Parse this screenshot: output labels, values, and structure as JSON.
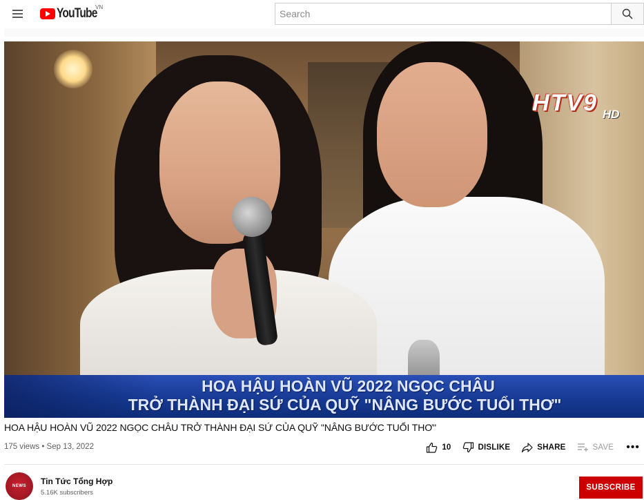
{
  "header": {
    "logo_text": "YouTube",
    "country_code": "VN",
    "search_placeholder": "Search"
  },
  "player": {
    "channel_logo": "HTV9",
    "channel_logo_hd": "HD",
    "caption_line1": "HOA HẬU HOÀN VŨ 2022 NGỌC CHÂU",
    "caption_line2": "TRỞ THÀNH ĐẠI SỨ CỦA QUỸ \"NÂNG BƯỚC TUỔI THƠ\""
  },
  "video": {
    "title": "HOA HẬU HOÀN VŨ 2022 NGỌC CHÂU TRỞ THÀNH ĐẠI SỨ CỦA QUỸ \"NÂNG BƯỚC TUỔI THƠ\"",
    "meta": "175 views • Sep 13, 2022",
    "like_count": "10",
    "dislike_label": "DISLIKE",
    "share_label": "SHARE",
    "save_label": "SAVE",
    "more_label": "•••"
  },
  "channel": {
    "name": "Tin Tức Tổng Hợp",
    "subscribers": "5.16K subscribers",
    "avatar_text": "NEWS",
    "subscribe_label": "SUBSCRIBE"
  },
  "colors": {
    "brand_red": "#ff0000",
    "subscribe_red": "#cc0000",
    "caption_blue": "#173a94"
  },
  "icons": {
    "menu": "hamburger-icon",
    "search": "search-icon",
    "like": "thumbs-up-icon",
    "dislike": "thumbs-down-icon",
    "share": "share-arrow-icon",
    "save": "playlist-add-icon",
    "more": "more-horizontal-icon"
  }
}
